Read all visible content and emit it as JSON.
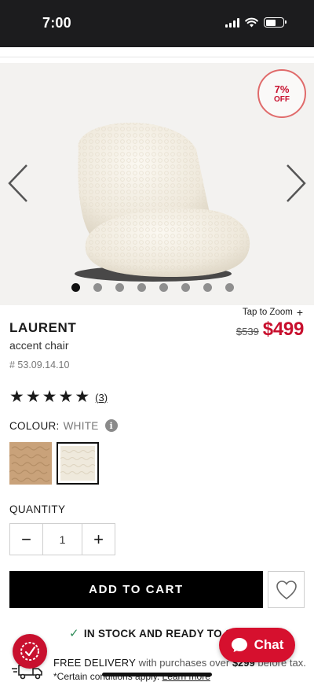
{
  "status_bar": {
    "time": "7:00"
  },
  "gallery": {
    "discount": {
      "percent": "7%",
      "off": "OFF"
    },
    "dot_count": 8,
    "active_dot": 0
  },
  "product": {
    "tap_to_zoom": "Tap to Zoom",
    "zoom_plus": "+",
    "old_price": "$539",
    "price": "$499",
    "name": "LAURENT",
    "type": "accent chair",
    "sku": "# 53.09.14.10",
    "rating": 5,
    "review_count": "(3)",
    "colour_label": "COLOUR:",
    "colour_value": "WHITE",
    "info_glyph": "i"
  },
  "swatches": [
    {
      "name": "tan",
      "color": "#c9a27a"
    },
    {
      "name": "white",
      "color": "#efe9dc"
    }
  ],
  "quantity": {
    "label": "QUANTITY",
    "value": "1",
    "minus": "−",
    "plus": "+"
  },
  "actions": {
    "add_to_cart": "ADD TO CART"
  },
  "stock": {
    "check": "✓",
    "text": "IN STOCK AND READY TO S"
  },
  "delivery": {
    "free": "FREE DELIVERY",
    "with": "with purchases over",
    "threshold": "$299",
    "before_tax": "before tax.",
    "conditions": "*Certain conditions apply.",
    "learn_more": "Learn more"
  },
  "chat": {
    "label": "Chat"
  },
  "colors": {
    "accent": "#c8102e",
    "check": "#2e8b57"
  }
}
